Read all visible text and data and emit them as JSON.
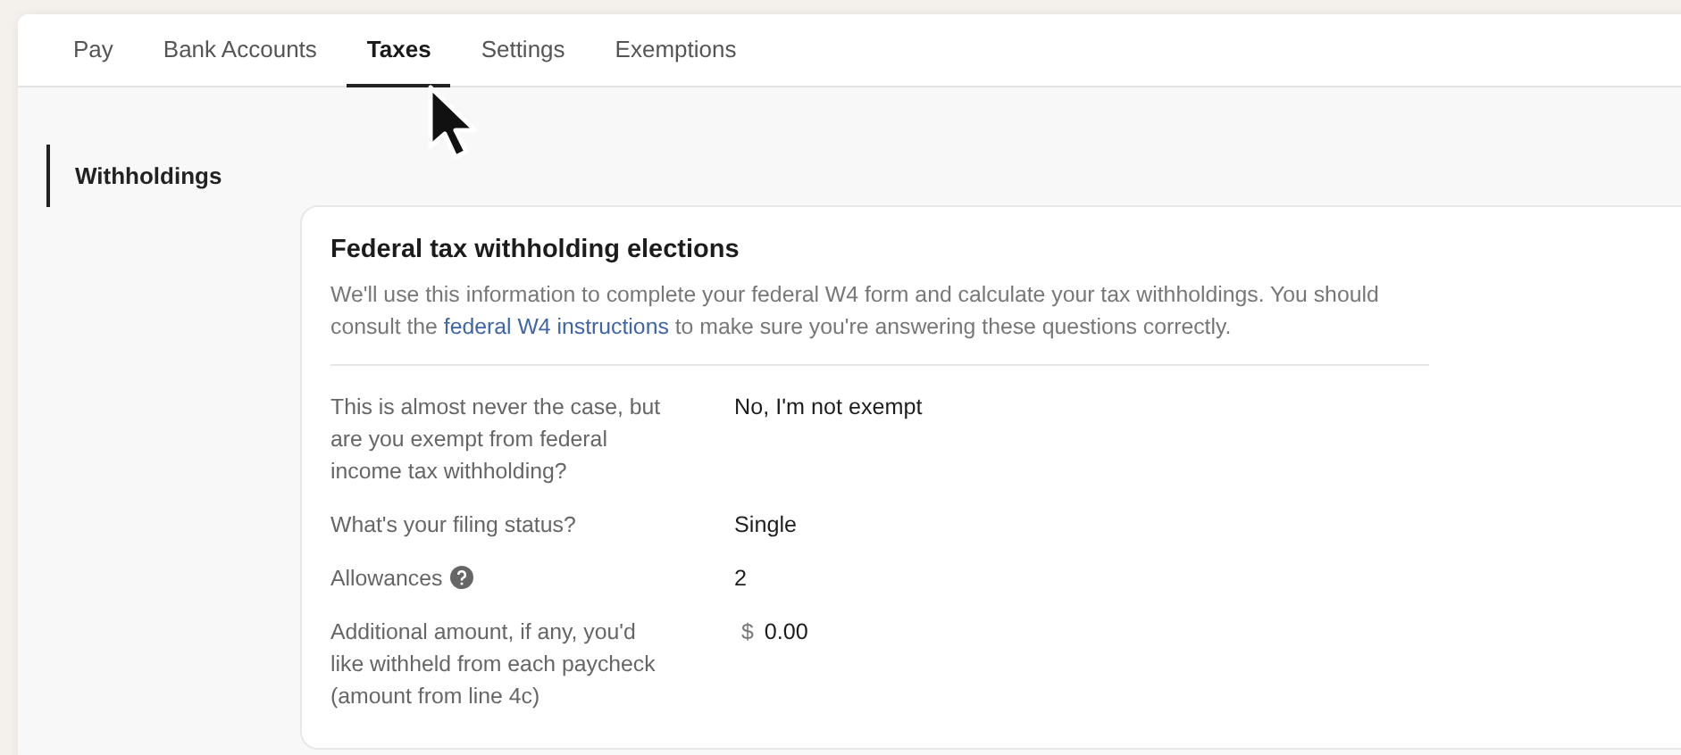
{
  "tabs": [
    {
      "label": "Pay",
      "selected": false
    },
    {
      "label": "Bank Accounts",
      "selected": false
    },
    {
      "label": "Taxes",
      "selected": true
    },
    {
      "label": "Settings",
      "selected": false
    },
    {
      "label": "Exemptions",
      "selected": false
    }
  ],
  "sidebar": {
    "items": [
      {
        "label": "Withholdings",
        "selected": true
      }
    ]
  },
  "card": {
    "title": "Federal tax withholding elections",
    "description": {
      "before": "We'll use this information to complete your federal W4 form and calculate your tax withholdings. You should consult the ",
      "link": "federal W4 instructions",
      "after": " to make sure you're answering these questions correctly."
    },
    "rows": [
      {
        "label": "This is almost never the case, but are you exempt from federal income tax withholding?",
        "value": "No, I'm not exempt",
        "help": false
      },
      {
        "label": "What's your filing status?",
        "value": "Single",
        "help": false
      },
      {
        "label": "Allowances",
        "value": "2",
        "help": true
      },
      {
        "label": "Additional amount, if any, you'd like withheld from each paycheck (amount from line 4c)",
        "prefix": "$",
        "value": "0.00",
        "help": false
      }
    ]
  }
}
